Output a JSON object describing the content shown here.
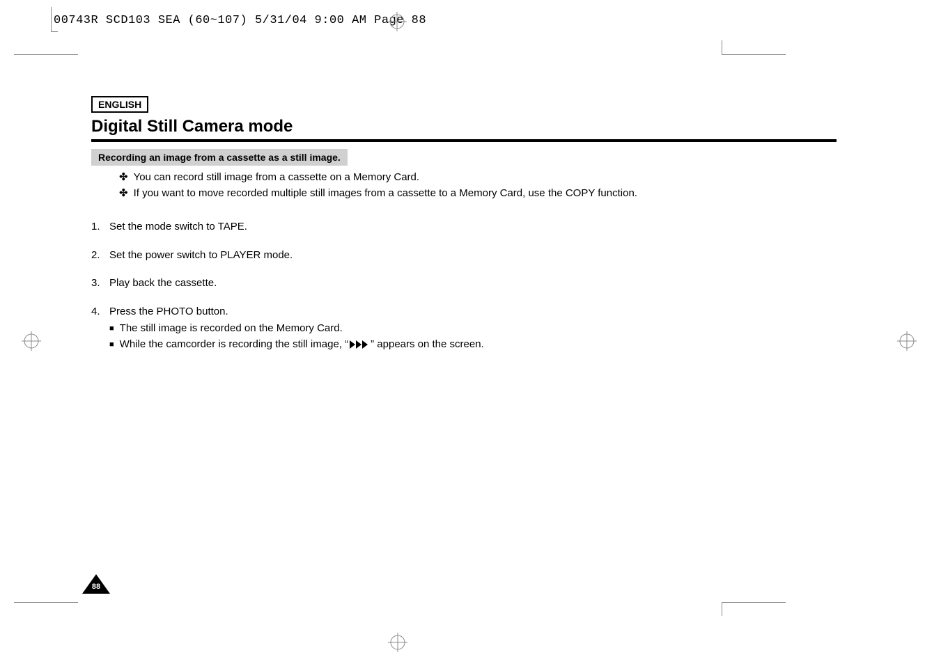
{
  "header": {
    "job_info": "00743R SCD103 SEA (60~107)  5/31/04 9:00 AM  Page 88"
  },
  "page": {
    "language_label": "ENGLISH",
    "chapter_title": "Digital Still Camera mode",
    "section_title": "Recording an image from a cassette as a still image.",
    "intro_bullets": [
      "You can record still image from a cassette on a Memory Card.",
      "If you want to move recorded multiple still images from a cassette to a Memory Card, use the COPY function."
    ],
    "steps": [
      {
        "num": "1.",
        "text": "Set the mode switch to TAPE."
      },
      {
        "num": "2.",
        "text": "Set the power switch to PLAYER mode."
      },
      {
        "num": "3.",
        "text": "Play back the cassette."
      },
      {
        "num": "4.",
        "text": "Press the PHOTO button."
      }
    ],
    "step4_sub": [
      "The still image is recorded on the Memory Card.",
      {
        "prefix": "While the camcorder is recording the still image, “",
        "icon": "fast-forward",
        "suffix": "” appears on the screen."
      }
    ],
    "page_number": "88"
  }
}
